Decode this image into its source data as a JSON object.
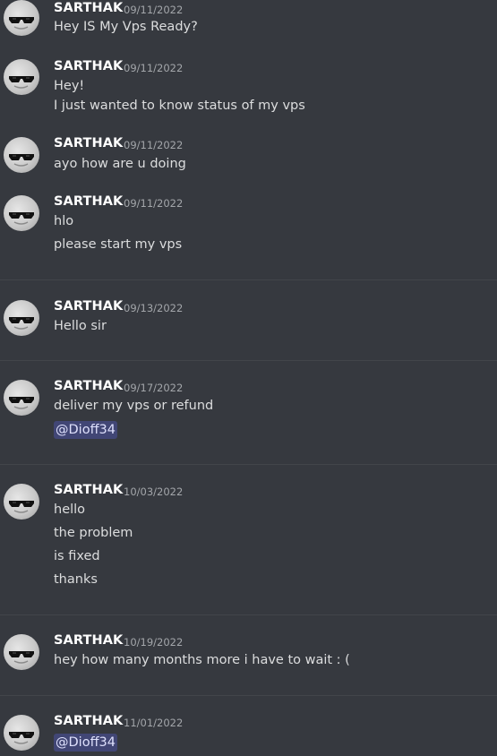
{
  "messages": [
    {
      "author": "SARTHAK",
      "timestamp": "09/11/2022",
      "lines": [
        "Hey IS My Vps Ready?"
      ]
    },
    {
      "author": "SARTHAK",
      "timestamp": "09/11/2022",
      "lines": [
        "Hey!",
        "I just wanted to know status of my vps"
      ]
    },
    {
      "author": "SARTHAK",
      "timestamp": "09/11/2022",
      "lines": [
        "ayo how are u doing"
      ]
    },
    {
      "author": "SARTHAK",
      "timestamp": "09/11/2022",
      "lines": [
        "hlo",
        "please start my vps"
      ]
    },
    {
      "author": "SARTHAK",
      "timestamp": "09/13/2022",
      "lines": [
        "Hello sir"
      ]
    },
    {
      "author": "SARTHAK",
      "timestamp": "09/17/2022",
      "lines": [
        "deliver my vps or refund"
      ],
      "mention": "@Dioff34"
    },
    {
      "author": "SARTHAK",
      "timestamp": "10/03/2022",
      "lines": [
        "hello",
        "the problem",
        "is fixed",
        "thanks"
      ]
    },
    {
      "author": "SARTHAK",
      "timestamp": "10/19/2022",
      "lines": [
        "hey how many months more i have to wait : ("
      ]
    },
    {
      "author": "SARTHAK",
      "timestamp": "11/01/2022",
      "lines": [],
      "mention": "@Dioff34"
    }
  ],
  "theme": {
    "background": "#36393f",
    "text": "#dcddde",
    "author": "#ffffff",
    "timestamp": "#a3a6aa",
    "mention_bg": "#414675",
    "mention_text": "#dee0fc",
    "divider": "#42454a"
  },
  "avatar_icon": "sunglasses-icon"
}
